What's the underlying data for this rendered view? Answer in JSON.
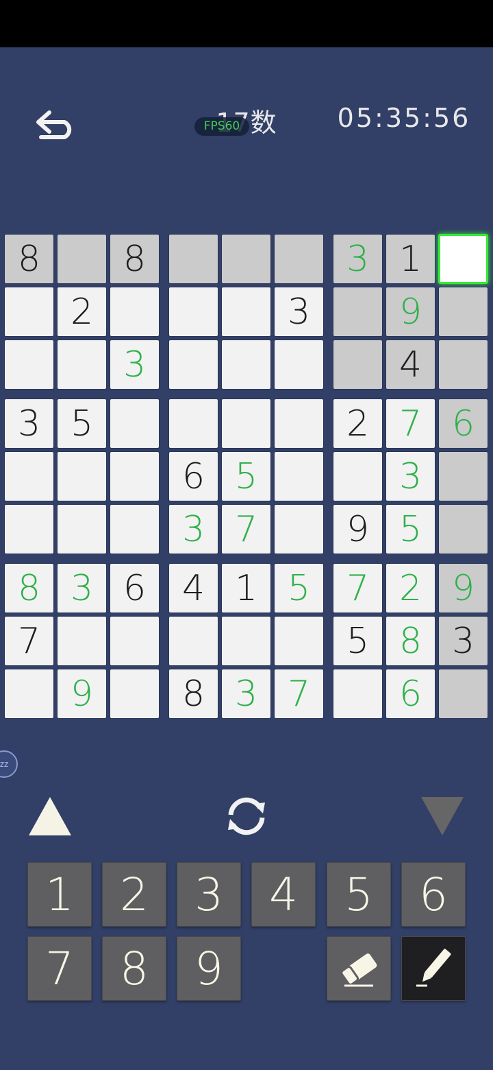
{
  "header": {
    "title": "17数",
    "fps_label": "FPS60",
    "timer": "05:35:56"
  },
  "grid": [
    [
      {
        "v": "8",
        "c": "k"
      },
      {
        "v": "",
        "c": ""
      },
      {
        "v": "8",
        "c": "k"
      },
      {
        "v": "",
        "c": ""
      },
      {
        "v": "",
        "c": ""
      },
      {
        "v": "",
        "c": ""
      },
      {
        "v": "3",
        "c": "g"
      },
      {
        "v": "1",
        "c": "k"
      },
      {
        "v": "",
        "c": ""
      }
    ],
    [
      {
        "v": "",
        "c": ""
      },
      {
        "v": "2",
        "c": "k"
      },
      {
        "v": "",
        "c": ""
      },
      {
        "v": "",
        "c": ""
      },
      {
        "v": "",
        "c": ""
      },
      {
        "v": "3",
        "c": "k"
      },
      {
        "v": "",
        "c": ""
      },
      {
        "v": "9",
        "c": "g"
      },
      {
        "v": "",
        "c": ""
      }
    ],
    [
      {
        "v": "",
        "c": ""
      },
      {
        "v": "",
        "c": ""
      },
      {
        "v": "3",
        "c": "g"
      },
      {
        "v": "",
        "c": ""
      },
      {
        "v": "",
        "c": ""
      },
      {
        "v": "",
        "c": ""
      },
      {
        "v": "",
        "c": ""
      },
      {
        "v": "4",
        "c": "k"
      },
      {
        "v": "",
        "c": ""
      }
    ],
    [
      {
        "v": "3",
        "c": "k"
      },
      {
        "v": "5",
        "c": "k"
      },
      {
        "v": "",
        "c": ""
      },
      {
        "v": "",
        "c": ""
      },
      {
        "v": "",
        "c": ""
      },
      {
        "v": "",
        "c": ""
      },
      {
        "v": "2",
        "c": "k"
      },
      {
        "v": "7",
        "c": "g"
      },
      {
        "v": "6",
        "c": "g"
      }
    ],
    [
      {
        "v": "",
        "c": ""
      },
      {
        "v": "",
        "c": ""
      },
      {
        "v": "",
        "c": ""
      },
      {
        "v": "6",
        "c": "k"
      },
      {
        "v": "5",
        "c": "g"
      },
      {
        "v": "",
        "c": ""
      },
      {
        "v": "",
        "c": ""
      },
      {
        "v": "3",
        "c": "g"
      },
      {
        "v": "",
        "c": ""
      }
    ],
    [
      {
        "v": "",
        "c": ""
      },
      {
        "v": "",
        "c": ""
      },
      {
        "v": "",
        "c": ""
      },
      {
        "v": "3",
        "c": "g"
      },
      {
        "v": "7",
        "c": "g"
      },
      {
        "v": "",
        "c": ""
      },
      {
        "v": "9",
        "c": "k"
      },
      {
        "v": "5",
        "c": "g"
      },
      {
        "v": "",
        "c": ""
      }
    ],
    [
      {
        "v": "8",
        "c": "g"
      },
      {
        "v": "3",
        "c": "g"
      },
      {
        "v": "6",
        "c": "k"
      },
      {
        "v": "4",
        "c": "k"
      },
      {
        "v": "1",
        "c": "k"
      },
      {
        "v": "5",
        "c": "g"
      },
      {
        "v": "7",
        "c": "g"
      },
      {
        "v": "2",
        "c": "g"
      },
      {
        "v": "9",
        "c": "g"
      }
    ],
    [
      {
        "v": "7",
        "c": "k"
      },
      {
        "v": "",
        "c": ""
      },
      {
        "v": "",
        "c": ""
      },
      {
        "v": "",
        "c": ""
      },
      {
        "v": "",
        "c": ""
      },
      {
        "v": "",
        "c": ""
      },
      {
        "v": "5",
        "c": "k"
      },
      {
        "v": "8",
        "c": "g"
      },
      {
        "v": "3",
        "c": "k"
      }
    ],
    [
      {
        "v": "",
        "c": ""
      },
      {
        "v": "9",
        "c": "g"
      },
      {
        "v": "",
        "c": ""
      },
      {
        "v": "8",
        "c": "k"
      },
      {
        "v": "3",
        "c": "g"
      },
      {
        "v": "7",
        "c": "g"
      },
      {
        "v": "",
        "c": ""
      },
      {
        "v": "6",
        "c": "g"
      },
      {
        "v": ""
      }
    ]
  ],
  "shaded_cells": [
    [
      0,
      0
    ],
    [
      0,
      1
    ],
    [
      0,
      2
    ],
    [
      0,
      3
    ],
    [
      0,
      4
    ],
    [
      0,
      5
    ],
    [
      0,
      6
    ],
    [
      0,
      7
    ],
    [
      1,
      6
    ],
    [
      1,
      7
    ],
    [
      1,
      8
    ],
    [
      2,
      6
    ],
    [
      2,
      7
    ],
    [
      2,
      8
    ],
    [
      3,
      8
    ],
    [
      4,
      8
    ],
    [
      5,
      8
    ],
    [
      6,
      8
    ],
    [
      7,
      8
    ],
    [
      8,
      8
    ]
  ],
  "selected_cell": [
    0,
    8
  ],
  "side_badge": "zz",
  "keypad": {
    "digits": [
      "1",
      "2",
      "3",
      "4",
      "5",
      "6",
      "7",
      "8",
      "9"
    ],
    "eraser": "eraser-icon",
    "pencil": "pencil-icon"
  },
  "colors": {
    "given": "#1e1e1e",
    "entered": "#2fb14a",
    "background": "#323f66",
    "selected": "#38e83c"
  }
}
